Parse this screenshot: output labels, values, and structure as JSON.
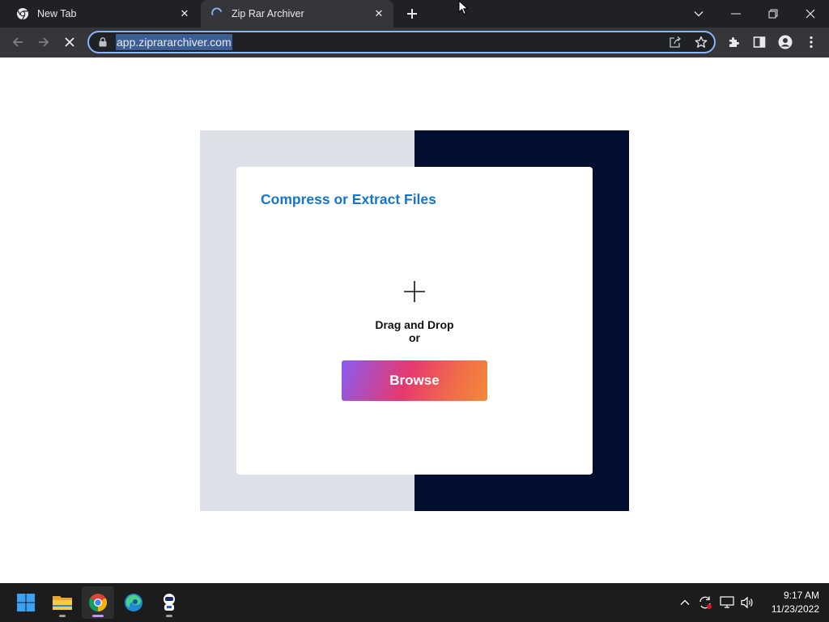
{
  "browser": {
    "tabs": [
      {
        "title": "New Tab",
        "icon": "chrome-icon",
        "active": false
      },
      {
        "title": "Zip Rar Archiver",
        "icon": "loading-spinner-icon",
        "active": true
      }
    ],
    "address_bar": {
      "url": "app.ziprararchiver.com",
      "selected": true,
      "icon": "lock-icon"
    },
    "nav": {
      "back": "back-arrow-icon",
      "forward": "forward-arrow-icon",
      "stop": "stop-icon"
    },
    "toolbar_icons": [
      "share-icon",
      "bookmark-star-icon",
      "extensions-icon",
      "side-panel-icon",
      "profile-icon",
      "menu-icon"
    ],
    "window_controls": [
      "tab-search-icon",
      "minimize-icon",
      "restore-icon",
      "close-icon"
    ]
  },
  "page": {
    "card_title": "Compress or Extract Files",
    "drop_line1": "Drag and Drop",
    "drop_line2": "or",
    "browse_label": "Browse",
    "colors": {
      "title": "#1576c9",
      "panel_left": "#dde0e6",
      "panel_right": "#010e30",
      "button_gradient": [
        "#8a5cf0",
        "#e6396f",
        "#f28a3a"
      ]
    }
  },
  "taskbar": {
    "apps": [
      {
        "name": "windows-start-icon",
        "active": false
      },
      {
        "name": "file-explorer-icon",
        "active": false
      },
      {
        "name": "chrome-icon",
        "active": true
      },
      {
        "name": "edge-icon",
        "active": false
      },
      {
        "name": "astronaut-app-icon",
        "active": false
      }
    ],
    "tray": [
      "chevron-up-icon",
      "sync-icon",
      "network-icon",
      "volume-icon"
    ],
    "time": "9:17 AM",
    "date": "11/23/2022"
  }
}
